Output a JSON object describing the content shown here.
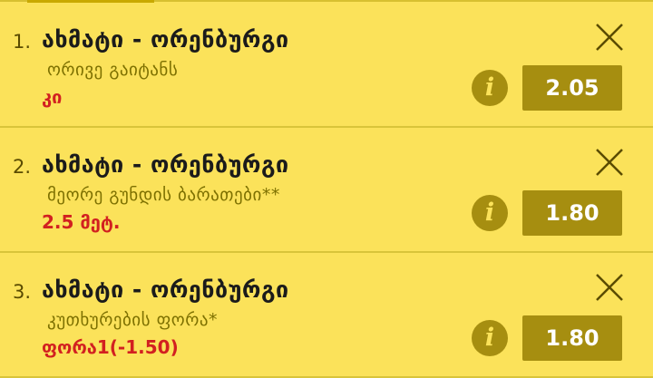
{
  "bets": [
    {
      "number": "1.",
      "match": "ახმატი - ორენბურგი",
      "market": "ორივე გაიტანს",
      "selection": "კი",
      "odds": "2.05",
      "info_icon": "info-icon",
      "close_icon": "close-icon"
    },
    {
      "number": "2.",
      "match": "ახმატი - ორენბურგი",
      "market": "მეორე გუნდის ბარათები**",
      "selection": "2.5 მეტ.",
      "odds": "1.80",
      "info_icon": "info-icon",
      "close_icon": "close-icon"
    },
    {
      "number": "3.",
      "match": "ახმატი - ორენბურგი",
      "market": "კუთხურების ფორა*",
      "selection": "ფორა1(-1.50)",
      "odds": "1.80",
      "info_icon": "info-icon",
      "close_icon": "close-icon"
    }
  ],
  "colors": {
    "background": "#fbe25a",
    "accent": "#a68e10",
    "selection": "#d22020",
    "market": "#7d7000"
  }
}
